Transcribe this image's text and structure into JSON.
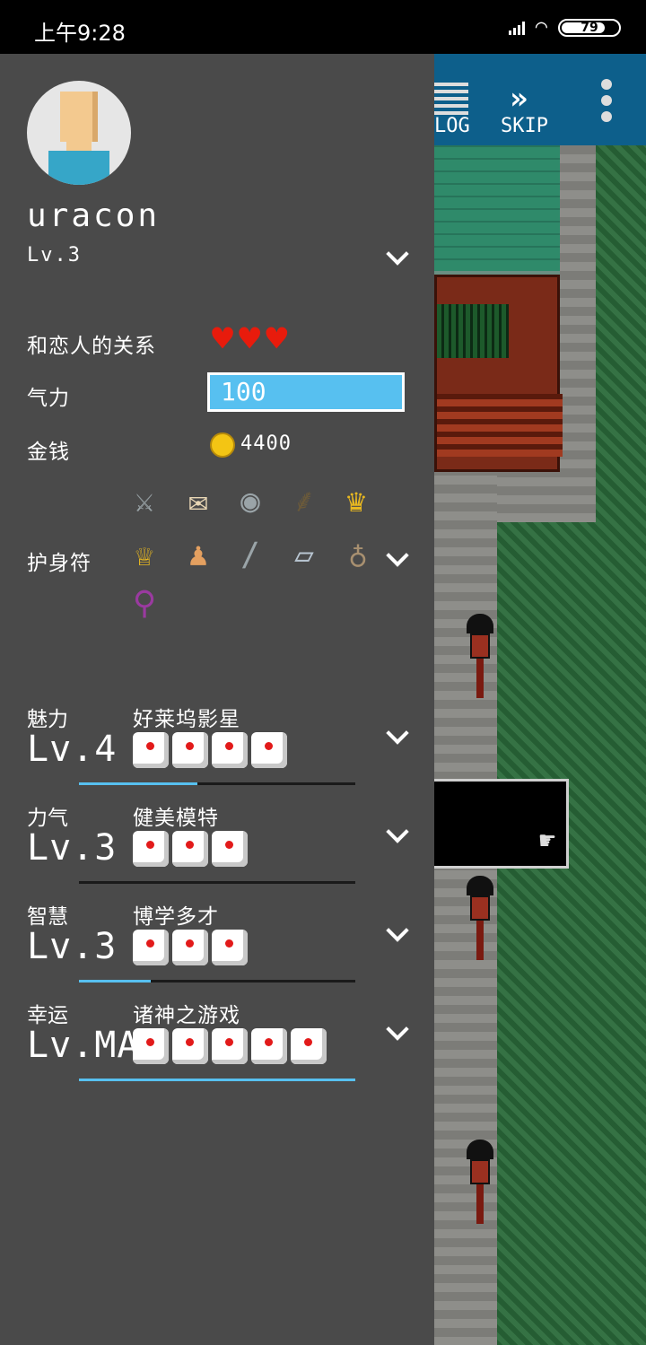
{
  "status_bar": {
    "time": "上午9:28",
    "battery": "79"
  },
  "game": {
    "log_label": "LOG",
    "skip_label": "SKIP"
  },
  "profile": {
    "username": "uracon",
    "level": "Lv.3"
  },
  "relationship": {
    "label": "和恋人的关系",
    "hearts": 3
  },
  "stamina": {
    "label": "气力",
    "value": "100"
  },
  "money": {
    "label": "金钱",
    "value": "4400"
  },
  "charms": {
    "label": "护身符",
    "items": [
      "sword-icon",
      "scroll-icon",
      "mirror-icon",
      "branch-icon",
      "crown-icon",
      "tiara-icon",
      "statue-icon",
      "blade-icon",
      "dice-vial-icon",
      "clay-figure-icon",
      "pendant-icon"
    ]
  },
  "stats": [
    {
      "name": "魅力",
      "title": "好莱坞影星",
      "level": "Lv.4",
      "dice": 4,
      "progress": 0.43
    },
    {
      "name": "力气",
      "title": "健美模特",
      "level": "Lv.3",
      "dice": 3,
      "progress": 0.0
    },
    {
      "name": "智慧",
      "title": "博学多才",
      "level": "Lv.3",
      "dice": 3,
      "progress": 0.26
    },
    {
      "name": "幸运",
      "title": "诸神之游戏",
      "level": "Lv.MAX",
      "dice": 5,
      "progress": 1.0
    }
  ],
  "colors": {
    "drawer": "#4a4a4a",
    "accent": "#57c0f0",
    "heart": "#e81b0c",
    "topbar": "#0d5f8b"
  }
}
